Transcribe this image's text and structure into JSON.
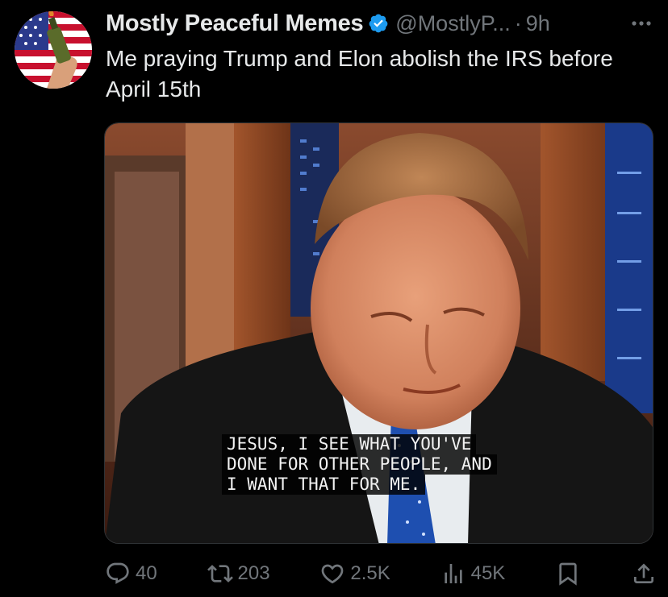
{
  "tweet": {
    "author_name": "Mostly Peaceful Memes",
    "handle": "@MostlyP...",
    "separator": "·",
    "time": "9h",
    "text": "Me praying Trump and Elon abolish the IRS before April 15th",
    "verified": true
  },
  "media": {
    "caption_lines": [
      "JESUS, I SEE WHAT YOU'VE",
      "DONE FOR OTHER PEOPLE, AND",
      "I WANT THAT FOR ME."
    ]
  },
  "actions": {
    "replies": "40",
    "reposts": "203",
    "likes": "2.5K",
    "views": "45K"
  },
  "colors": {
    "background": "#000000",
    "text": "#e7e9ea",
    "muted": "#71767b",
    "verified": "#1d9bf0"
  },
  "icons": [
    "reply-icon",
    "repost-icon",
    "like-icon",
    "views-icon",
    "bookmark-icon",
    "share-icon",
    "more-icon",
    "verified-badge-icon"
  ]
}
